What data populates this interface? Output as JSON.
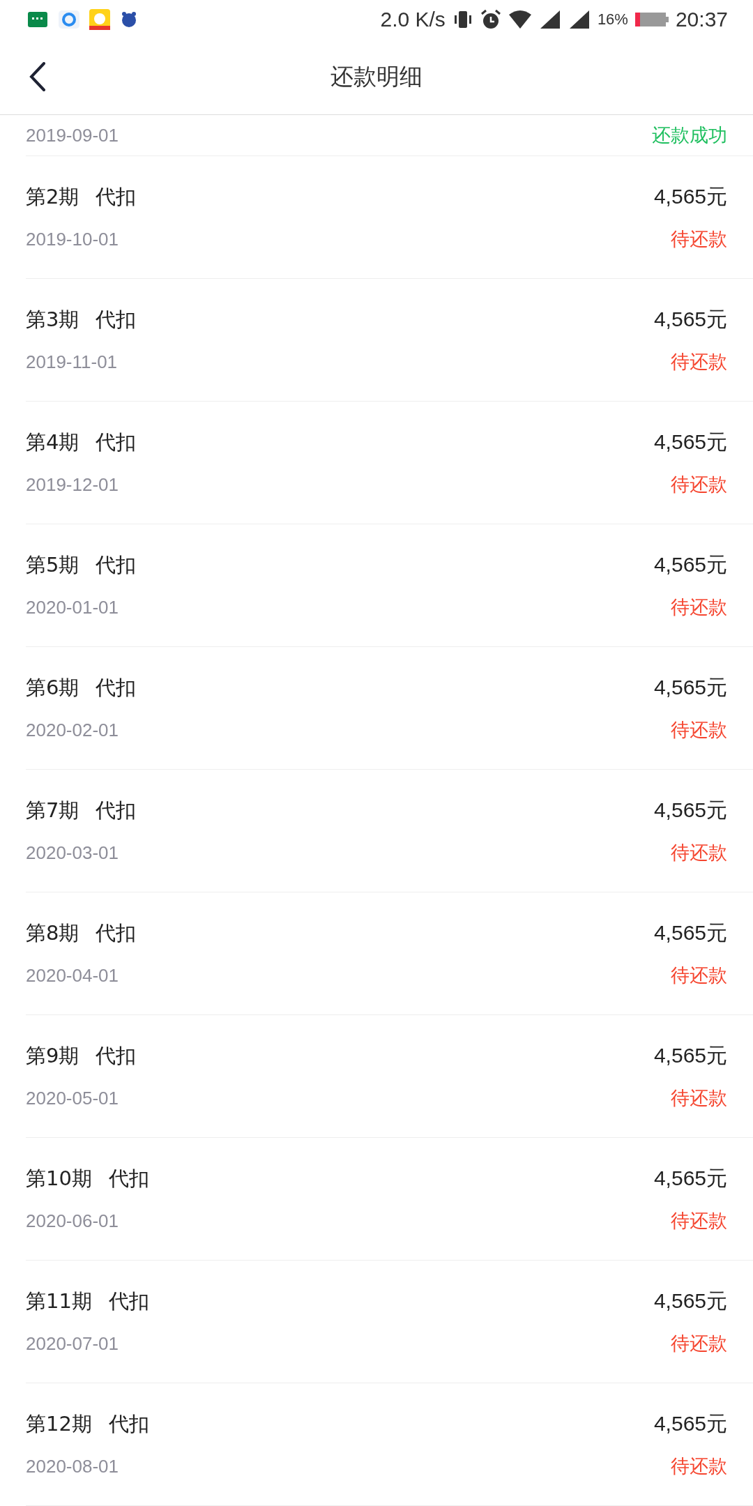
{
  "status_bar": {
    "speed": "2.0 K/s",
    "battery_text": "16%",
    "time": "20:37"
  },
  "header": {
    "title": "还款明细"
  },
  "partial_row": {
    "date": "2019-09-01",
    "status": "还款成功",
    "kind": "paid"
  },
  "rows": [
    {
      "period": "第2期",
      "method": "代扣",
      "amount": "4,565元",
      "date": "2019-10-01",
      "status": "待还款",
      "kind": "pending"
    },
    {
      "period": "第3期",
      "method": "代扣",
      "amount": "4,565元",
      "date": "2019-11-01",
      "status": "待还款",
      "kind": "pending"
    },
    {
      "period": "第4期",
      "method": "代扣",
      "amount": "4,565元",
      "date": "2019-12-01",
      "status": "待还款",
      "kind": "pending"
    },
    {
      "period": "第5期",
      "method": "代扣",
      "amount": "4,565元",
      "date": "2020-01-01",
      "status": "待还款",
      "kind": "pending"
    },
    {
      "period": "第6期",
      "method": "代扣",
      "amount": "4,565元",
      "date": "2020-02-01",
      "status": "待还款",
      "kind": "pending"
    },
    {
      "period": "第7期",
      "method": "代扣",
      "amount": "4,565元",
      "date": "2020-03-01",
      "status": "待还款",
      "kind": "pending"
    },
    {
      "period": "第8期",
      "method": "代扣",
      "amount": "4,565元",
      "date": "2020-04-01",
      "status": "待还款",
      "kind": "pending"
    },
    {
      "period": "第9期",
      "method": "代扣",
      "amount": "4,565元",
      "date": "2020-05-01",
      "status": "待还款",
      "kind": "pending"
    },
    {
      "period": "第10期",
      "method": "代扣",
      "amount": "4,565元",
      "date": "2020-06-01",
      "status": "待还款",
      "kind": "pending"
    },
    {
      "period": "第11期",
      "method": "代扣",
      "amount": "4,565元",
      "date": "2020-07-01",
      "status": "待还款",
      "kind": "pending"
    },
    {
      "period": "第12期",
      "method": "代扣",
      "amount": "4,565元",
      "date": "2020-08-01",
      "status": "待还款",
      "kind": "pending"
    }
  ]
}
